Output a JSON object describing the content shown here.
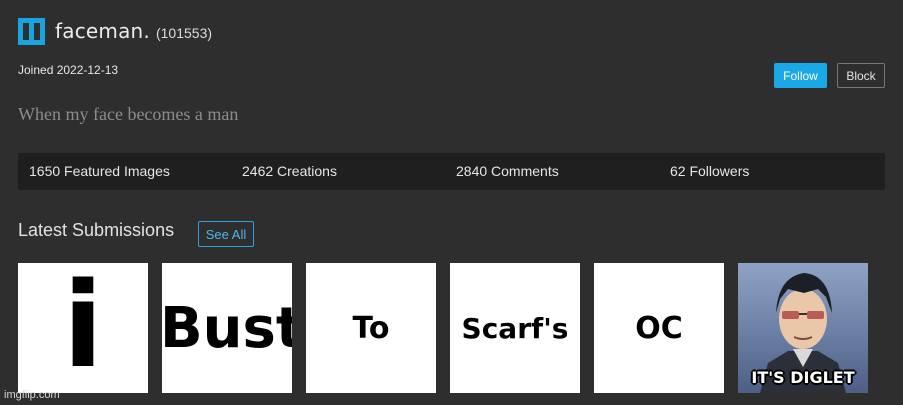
{
  "profile": {
    "username": "faceman.",
    "user_id": "(101553)",
    "joined": "Joined 2022-12-13",
    "bio": "When my face becomes a man"
  },
  "actions": {
    "follow_label": "Follow",
    "block_label": "Block"
  },
  "stats": [
    {
      "label": "1650 Featured Images"
    },
    {
      "label": "2462 Creations"
    },
    {
      "label": "2840 Comments"
    },
    {
      "label": "62 Followers"
    }
  ],
  "latest": {
    "heading": "Latest Submissions",
    "see_all": "See All"
  },
  "thumbnails": [
    {
      "text": "i"
    },
    {
      "text": "Bust"
    },
    {
      "text": "To"
    },
    {
      "text": "Scarf's"
    },
    {
      "text": "OC"
    },
    {
      "caption": "IT'S DIGLET"
    }
  ],
  "watermark": "imgflip.com",
  "colors": {
    "background": "#2e2e2e",
    "accent": "#1aa8e6",
    "stats_bar": "#1f1f1f"
  }
}
